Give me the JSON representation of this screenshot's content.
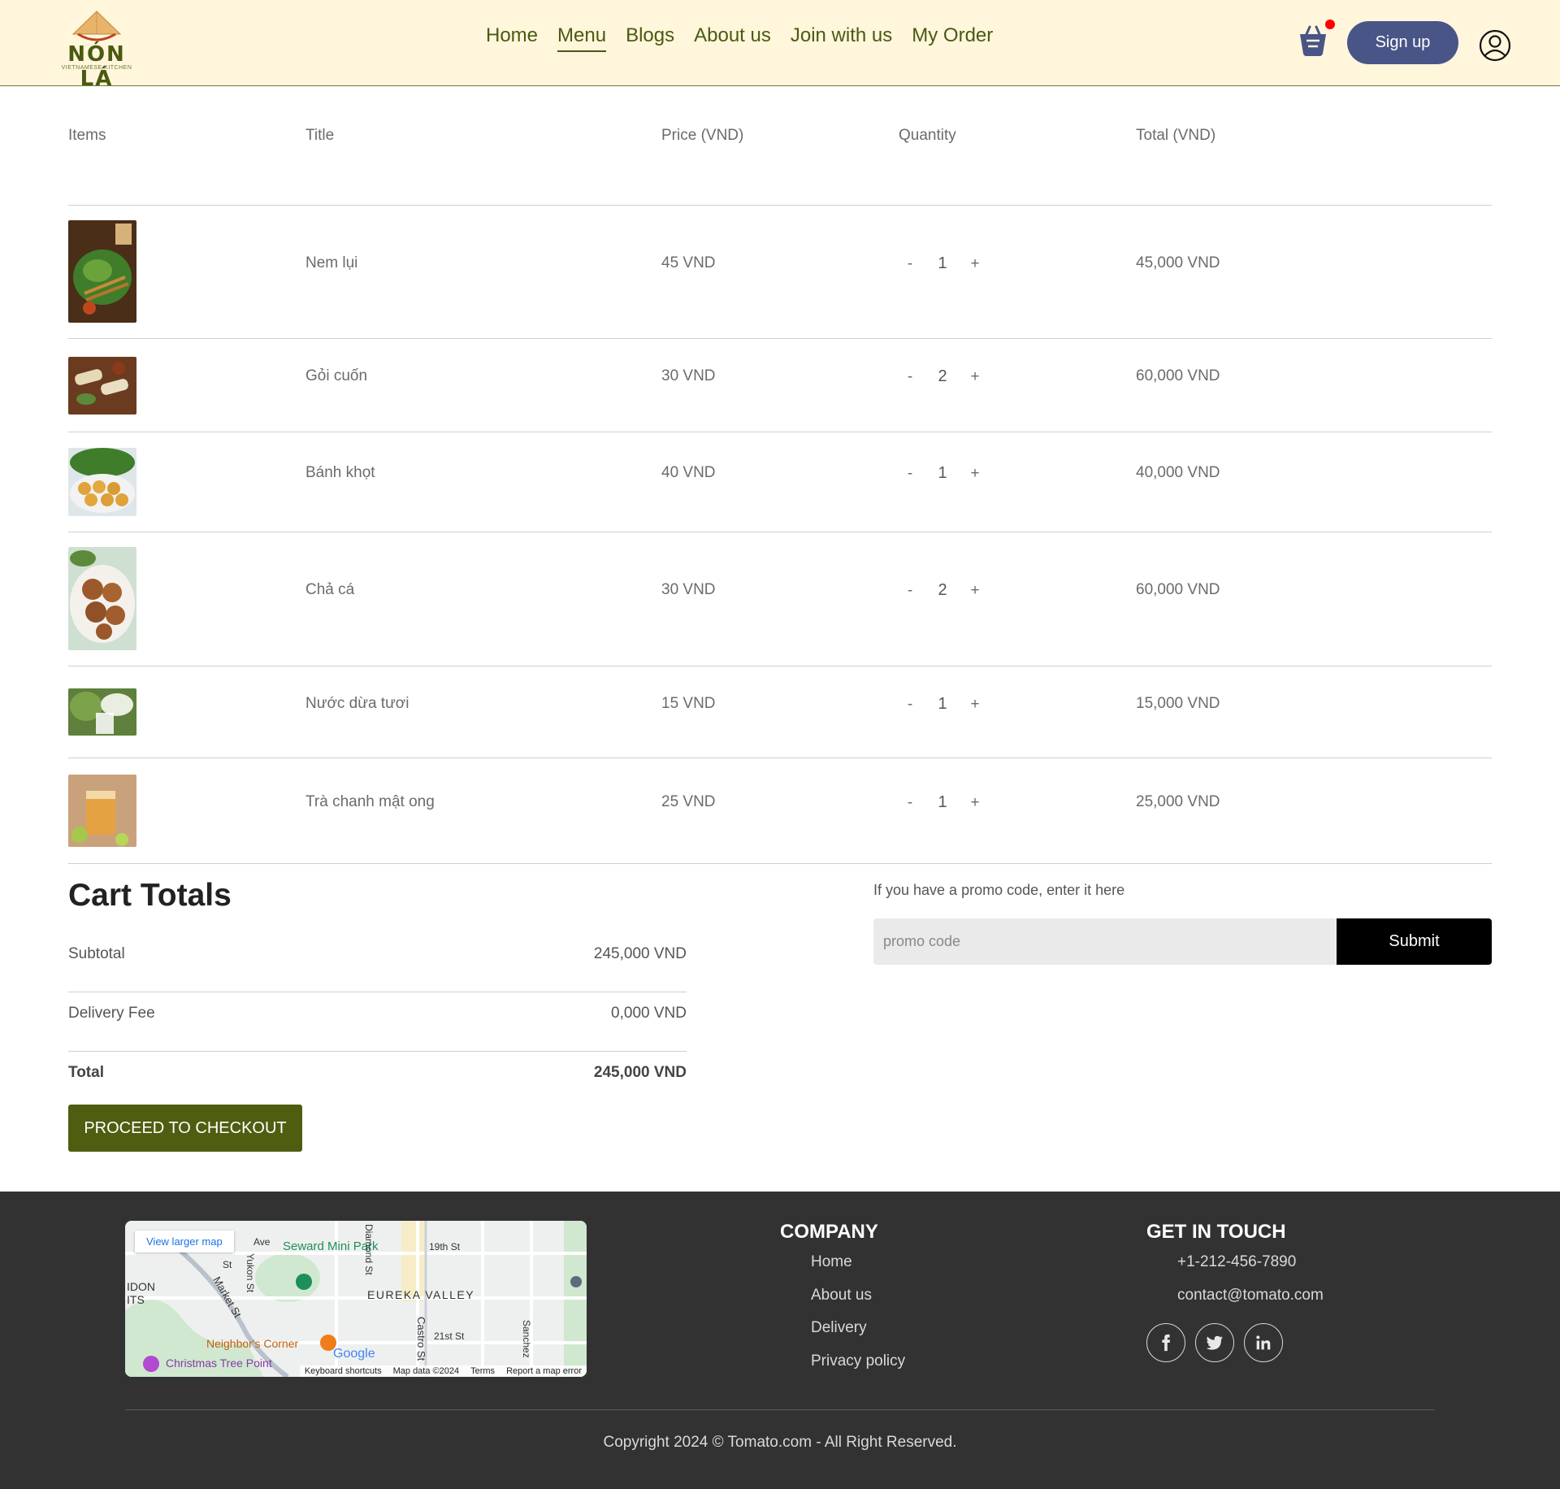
{
  "brand": {
    "name": "NÓN LÁ",
    "tagline": "VIETNAMESE KITCHEN"
  },
  "nav": {
    "items": [
      "Home",
      "Menu",
      "Blogs",
      "About us",
      "Join with us",
      "My Order"
    ],
    "active": "Menu",
    "signup_label": "Sign up",
    "basket_has_items": true
  },
  "cart": {
    "headers": {
      "items": "Items",
      "title": "Title",
      "price": "Price (VND)",
      "quantity": "Quantity",
      "total": "Total (VND)"
    },
    "minus_label": "-",
    "plus_label": "+",
    "rows": [
      {
        "title": "Nem lụi",
        "price": "45 VND",
        "qty": "1",
        "total": "45,000 VND",
        "image": "nem-lui-photo"
      },
      {
        "title": "Gỏi cuốn",
        "price": "30 VND",
        "qty": "2",
        "total": "60,000 VND",
        "image": "goi-cuon-photo"
      },
      {
        "title": "Bánh khọt",
        "price": "40 VND",
        "qty": "1",
        "total": "40,000 VND",
        "image": "banh-khot-photo"
      },
      {
        "title": "Chả cá",
        "price": "30 VND",
        "qty": "2",
        "total": "60,000 VND",
        "image": "cha-ca-photo"
      },
      {
        "title": "Nước dừa tươi",
        "price": "15 VND",
        "qty": "1",
        "total": "15,000 VND",
        "image": "nuoc-dua-photo"
      },
      {
        "title": "Trà chanh mật ong",
        "price": "25 VND",
        "qty": "1",
        "total": "25,000 VND",
        "image": "tra-chanh-photo"
      }
    ]
  },
  "totals": {
    "title": "Cart Totals",
    "subtotal_label": "Subtotal",
    "subtotal_value": "245,000 VND",
    "delivery_label": "Delivery Fee",
    "delivery_value": "0,000 VND",
    "total_label": "Total",
    "total_value": "245,000 VND",
    "checkout_label": "PROCEED TO CHECKOUT"
  },
  "promo": {
    "label": "If you have a promo code, enter it here",
    "placeholder": "promo code",
    "submit_label": "Submit"
  },
  "footer": {
    "map": {
      "view_larger": "View larger map",
      "labels": [
        "Seward Mini Park",
        "EUREKA VALLEY",
        "Neighbor's Corner",
        "Christmas Tree Point",
        "Market St",
        "Castro St",
        "19th St",
        "21st St",
        "Diamond St",
        "Yukon St",
        "Sanchez",
        "Ave",
        "St",
        "IDON",
        "ITS"
      ],
      "google": "Google",
      "credits": [
        "Keyboard shortcuts",
        "Map data ©2024",
        "Terms",
        "Report a map error"
      ]
    },
    "company_title": "COMPANY",
    "company_links": [
      "Home",
      "About us",
      "Delivery",
      "Privacy policy"
    ],
    "contact_title": "GET IN TOUCH",
    "phone": "+1-212-456-7890",
    "email": "contact@tomato.com",
    "social": [
      "facebook-icon",
      "twitter-icon",
      "linkedin-icon"
    ],
    "copyright": "Copyright 2024 © Tomato.com - All Right Reserved."
  },
  "colors": {
    "navbar_bg": "#fff6dc",
    "brand_green": "#4a5a10",
    "signup_bg": "#485586",
    "checkout_bg": "#4f5d10",
    "footer_bg": "#323232",
    "badge_red": "#ff0000"
  }
}
